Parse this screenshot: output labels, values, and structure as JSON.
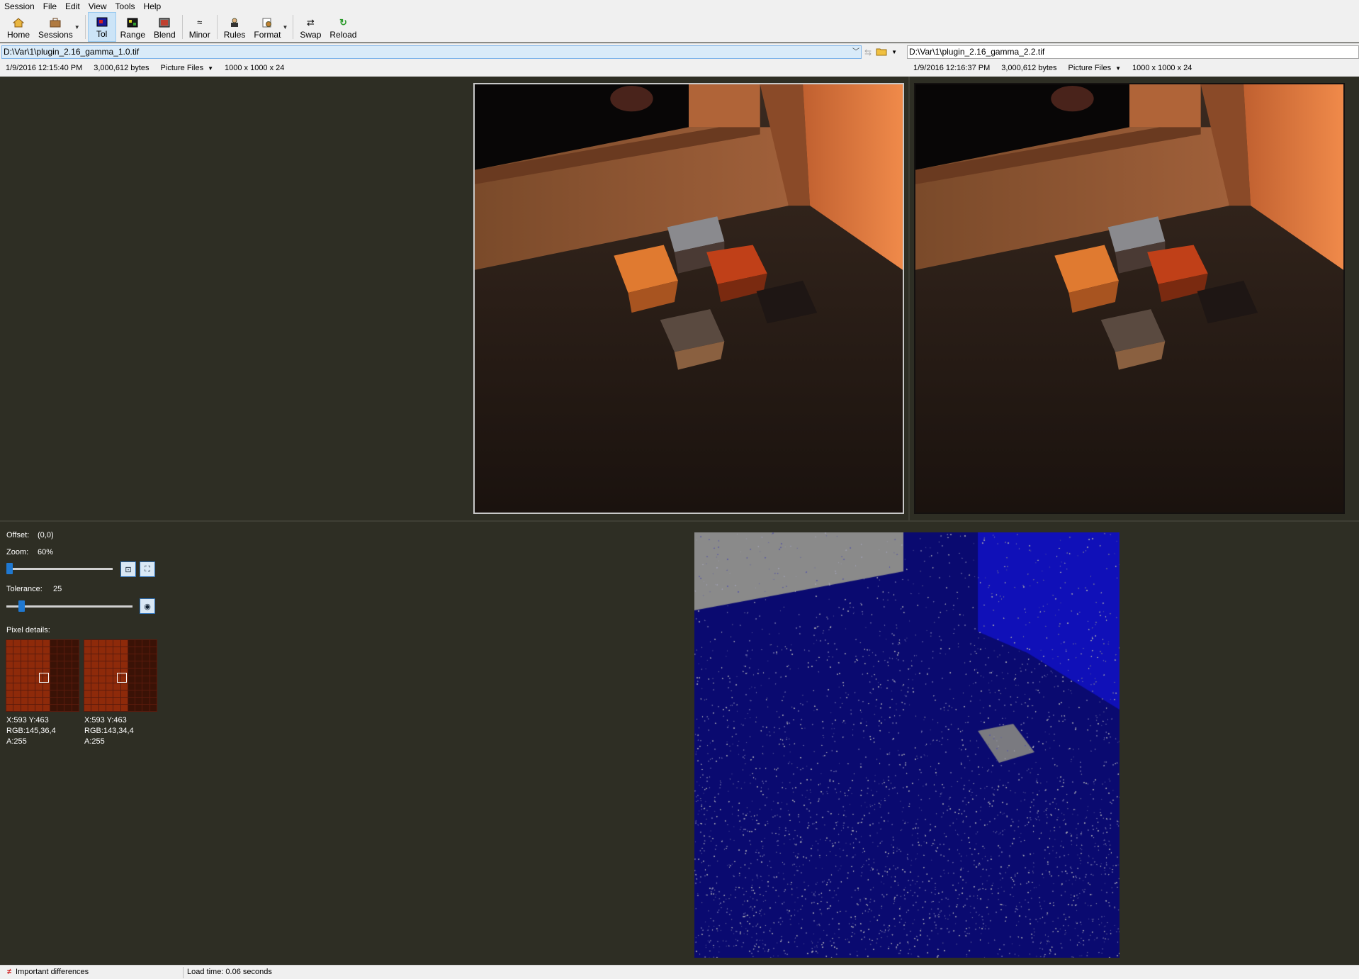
{
  "menu": [
    "Session",
    "File",
    "Edit",
    "View",
    "Tools",
    "Help"
  ],
  "toolbar": {
    "home": "Home",
    "sessions": "Sessions",
    "tol": "Tol",
    "range": "Range",
    "blend": "Blend",
    "minor": "Minor",
    "rules": "Rules",
    "format": "Format",
    "swap": "Swap",
    "reload": "Reload"
  },
  "left": {
    "path": "D:\\Var\\1\\plugin_2.16_gamma_1.0.tif",
    "date": "1/9/2016 12:15:40 PM",
    "size": "3,000,612 bytes",
    "filter": "Picture Files",
    "dims": "1000 x 1000 x 24"
  },
  "right": {
    "path": "D:\\Var\\1\\plugin_2.16_gamma_2.2.tif",
    "date": "1/9/2016 12:16:37 PM",
    "size": "3,000,612 bytes",
    "filter": "Picture Files",
    "dims": "1000 x 1000 x 24"
  },
  "controls": {
    "offset_label": "Offset:",
    "offset_value": "(0,0)",
    "zoom_label": "Zoom:",
    "zoom_value": "60%",
    "zoom_fraction": 0.0,
    "tolerance_label": "Tolerance:",
    "tolerance_value": "25",
    "tolerance_fraction": 0.1,
    "pixel_details_label": "Pixel details:"
  },
  "pixels": [
    {
      "xy": "X:593 Y:463",
      "rgb": "RGB:145,36,4",
      "a": "A:255"
    },
    {
      "xy": "X:593 Y:463",
      "rgb": "RGB:143,34,4",
      "a": "A:255"
    }
  ],
  "status": {
    "diff": "Important differences",
    "load": "Load time: 0.06 seconds"
  },
  "colors": {
    "background": "#2e2e24",
    "diff_blue": "#0a0a6e",
    "selected_button": "#cce4f7"
  }
}
